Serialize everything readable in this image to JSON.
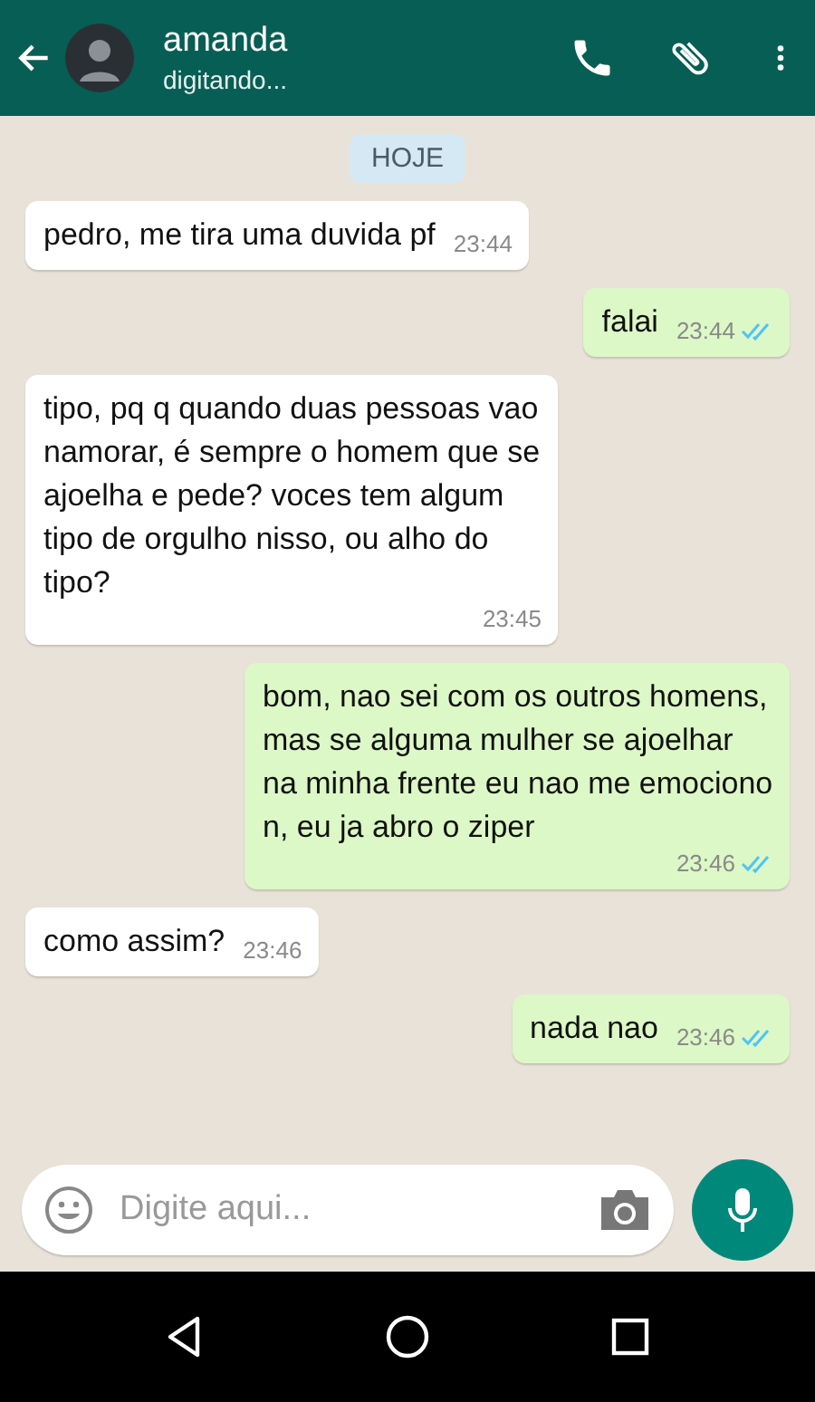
{
  "header": {
    "name": "amanda",
    "status": "digitando..."
  },
  "date_badge": "HOJE",
  "messages": [
    {
      "kind": "incoming",
      "text": "pedro, me tira uma duvida pf",
      "time": "23:44"
    },
    {
      "kind": "outgoing",
      "text": "falai",
      "time": "23:44",
      "read": true
    },
    {
      "kind": "incoming",
      "text": "tipo, pq q quando duas pessoas vao namorar, é sempre o homem que se ajoelha e pede? voces tem algum tipo de orgulho nisso, ou alho do tipo?",
      "time": "23:45"
    },
    {
      "kind": "outgoing",
      "text": "bom, nao sei com os outros homens, mas se alguma mulher se ajoelhar na minha frente eu nao me emociono n, eu ja abro o ziper",
      "time": "23:46",
      "read": true
    },
    {
      "kind": "incoming",
      "text": "como assim?",
      "time": "23:46"
    },
    {
      "kind": "outgoing",
      "text": "nada nao",
      "time": "23:46",
      "read": true
    }
  ],
  "composer": {
    "placeholder": "Digite aqui..."
  }
}
